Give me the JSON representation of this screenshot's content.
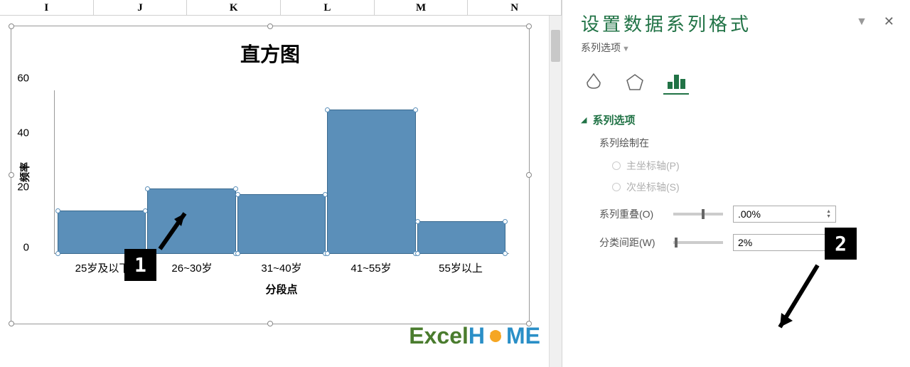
{
  "columns": [
    "I",
    "J",
    "K",
    "L",
    "M",
    "N"
  ],
  "chart_data": {
    "type": "bar",
    "title": "直方图",
    "xlabel": "分段点",
    "ylabel": "频率",
    "categories": [
      "25岁及以下",
      "26~30岁",
      "31~40岁",
      "41~55岁",
      "55岁以上"
    ],
    "values": [
      16,
      24,
      22,
      53,
      12
    ],
    "ylim": [
      0,
      60
    ],
    "yticks": [
      0,
      20,
      40,
      60
    ]
  },
  "panel": {
    "title": "设置数据系列格式",
    "subtitle": "系列选项",
    "section": {
      "title": "系列选项",
      "plot_on_label": "系列绘制在",
      "primary_axis": "主坐标轴(P)",
      "secondary_axis": "次坐标轴(S)",
      "overlap_label": "系列重叠(O)",
      "overlap_value": ".00%",
      "gap_label": "分类间距(W)",
      "gap_value": "2%"
    }
  },
  "callouts": {
    "one": "1",
    "two": "2"
  },
  "watermark": {
    "excel": "Excel",
    "h": "H",
    "me": "ME"
  }
}
